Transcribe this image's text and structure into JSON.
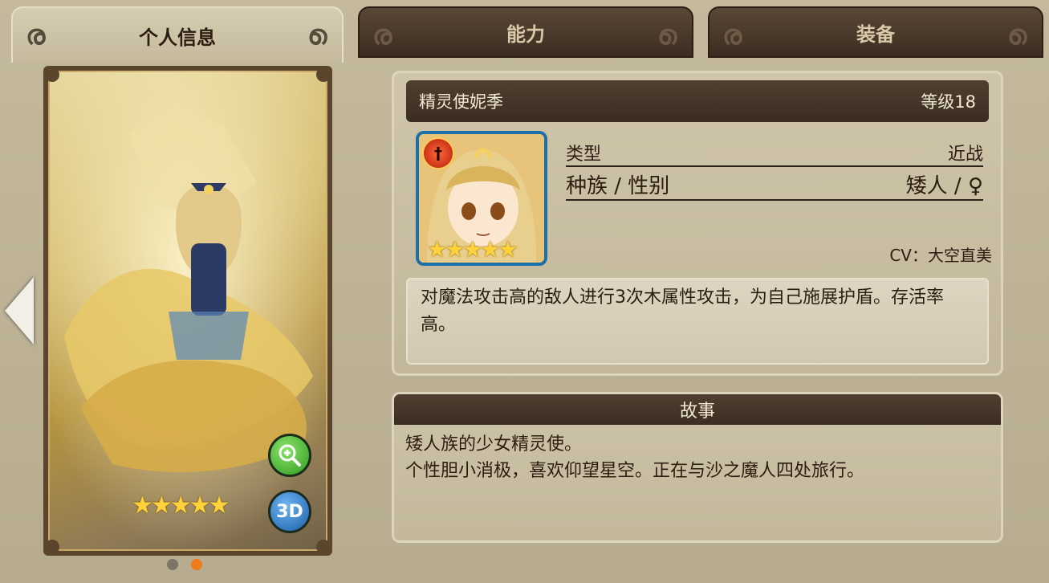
{
  "tabs": [
    {
      "label": "个人信息",
      "active": true
    },
    {
      "label": "能力",
      "active": false
    },
    {
      "label": "装备",
      "active": false
    }
  ],
  "card": {
    "rarity_stars": "★★★★★",
    "zoom_icon": "zoom-in-icon",
    "view3d_label": "3D"
  },
  "pager": {
    "count": 2,
    "active_index": 1
  },
  "character": {
    "name": "精灵使妮季",
    "level": "等级18",
    "portrait_stars": "★★★★★",
    "type_label": "类型",
    "type_value": "近战",
    "race_gender_label": "种族 / 性别",
    "race_gender_value": "矮人 / ♀",
    "cv": "CV：大空直美",
    "description": "对魔法攻击高的敌人进行3次木属性攻击，为自己施展护盾。存活率高。"
  },
  "story": {
    "title": "故事",
    "line1": "矮人族的少女精灵使。",
    "line2": "个性胆小消极，喜欢仰望星空。正在与沙之魔人四处旅行。"
  },
  "colors": {
    "accent_orange": "#f07b1d",
    "panel_dark": "#3a2d21",
    "zoom_green": "#3fae2e",
    "view3d_blue": "#2277c9"
  }
}
